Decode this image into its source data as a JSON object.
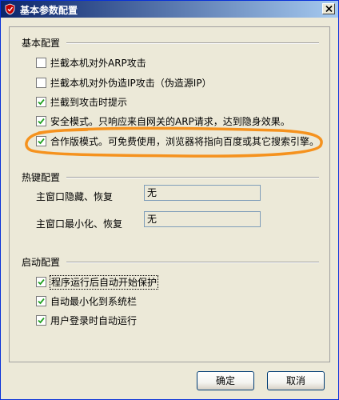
{
  "window": {
    "title": "基本参数配置",
    "close_symbol": "×"
  },
  "basic_config": {
    "title": "基本配置",
    "options": [
      {
        "label": "拦截本机对外ARP攻击",
        "checked": false
      },
      {
        "label": "拦截本机对外伪造IP攻击（伪造源IP）",
        "checked": false
      },
      {
        "label": "拦截到攻击时提示",
        "checked": true
      },
      {
        "label": "安全模式。只响应来自网关的ARP请求，达到隐身效果。",
        "checked": true
      },
      {
        "label": "合作版模式。可免费使用，浏览器将指向百度或其它搜索引擎。",
        "checked": true
      }
    ]
  },
  "hotkey_config": {
    "title": "热键配置",
    "rows": [
      {
        "label": "主窗口隐藏、恢复",
        "value": "无"
      },
      {
        "label": "主窗口最小化、恢复",
        "value": "无"
      }
    ]
  },
  "startup_config": {
    "title": "启动配置",
    "options": [
      {
        "label": "程序运行后自动开始保护",
        "checked": true
      },
      {
        "label": "自动最小化到系统栏",
        "checked": true
      },
      {
        "label": "用户登录时自动运行",
        "checked": true
      }
    ]
  },
  "buttons": {
    "ok_label": "确定",
    "cancel_label": "取消"
  },
  "colors": {
    "annotation_orange": "#f5921e",
    "title_gradient_start": "#0a246a",
    "title_gradient_end": "#a6caf0"
  },
  "icons": {
    "app": "shield-icon",
    "close": "close-icon",
    "check": "checkmark-icon"
  }
}
